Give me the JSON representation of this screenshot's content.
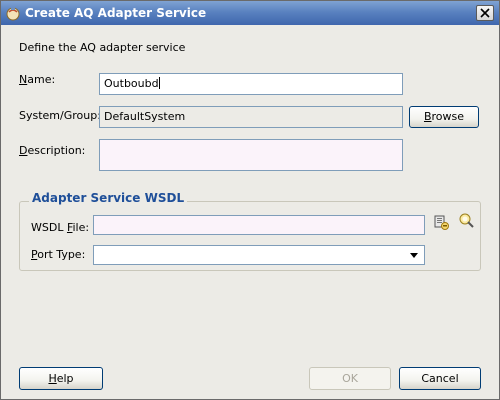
{
  "window": {
    "title": "Create AQ Adapter Service"
  },
  "intro": {
    "text": "Define the AQ adapter service"
  },
  "form": {
    "name": {
      "label_mnemonic": "N",
      "label_rest": "ame:",
      "value": "Outboubd"
    },
    "system_group": {
      "label": "System/Group:",
      "value": "DefaultSystem"
    },
    "browse": {
      "mnemonic": "B",
      "rest": "rowse"
    },
    "description": {
      "label_mnemonic": "D",
      "label_rest": "escription:",
      "value": ""
    }
  },
  "wsdl_group": {
    "title": "Adapter Service WSDL",
    "wsdl_file": {
      "label_pre": "WSDL ",
      "label_mnemonic": "F",
      "label_post": "ile:",
      "value": ""
    },
    "port_type": {
      "label_mnemonic": "P",
      "label_rest": "ort Type:",
      "selected": ""
    },
    "icons": [
      "wsdl-browse-icon",
      "service-explorer-icon"
    ]
  },
  "footer": {
    "help": {
      "mnemonic": "H",
      "rest": "elp"
    },
    "ok": "OK",
    "cancel": "Cancel"
  }
}
